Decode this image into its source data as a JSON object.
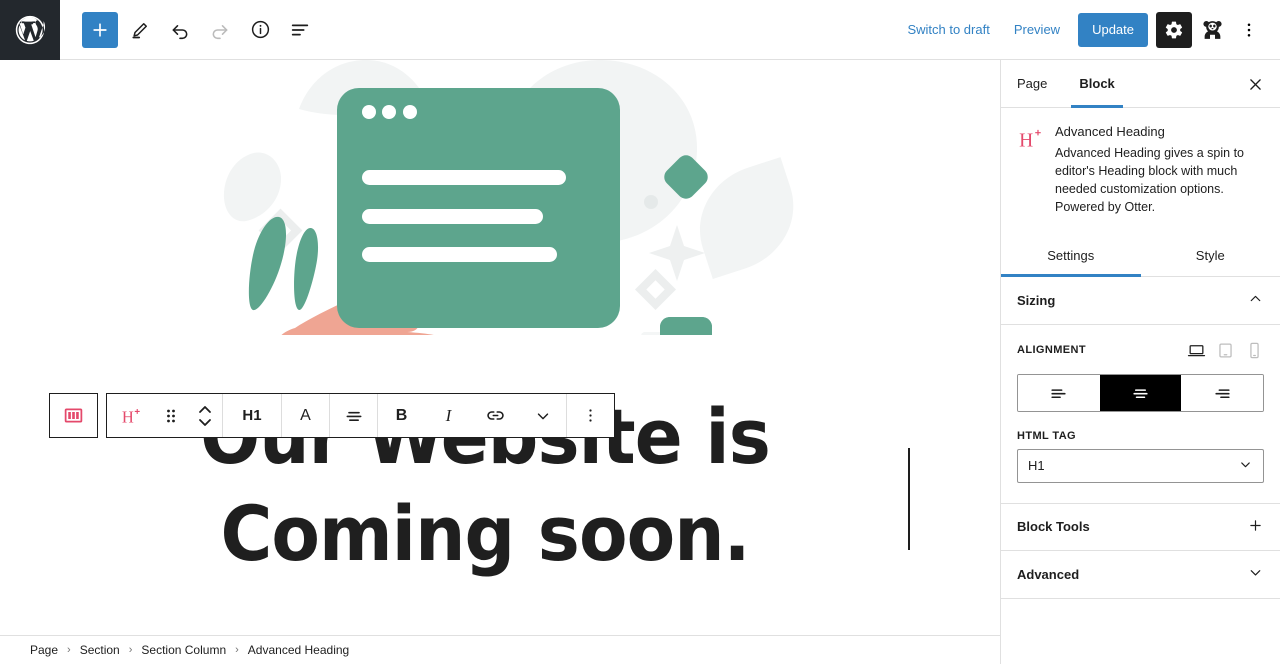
{
  "topbar": {
    "logo_icon": "wordpress-logo-icon",
    "add_block_icon": "plus-icon",
    "edit_icon": "pencil-icon",
    "undo_icon": "undo-arrow-icon",
    "redo_icon": "redo-arrow-icon",
    "info_icon": "info-circle-icon",
    "list_view_icon": "list-view-icon",
    "switch_to_draft_label": "Switch to draft",
    "preview_label": "Preview",
    "update_label": "Update",
    "settings_icon": "gear-icon",
    "avatar_icon": "panda-avatar-icon",
    "more_icon": "kebab-menu-icon",
    "accent_blue": "#3282c4",
    "logo_bg": "#23282d"
  },
  "block_toolbar": {
    "columns_icon": "columns-icon",
    "heading_plus_icon": "advanced-heading-icon",
    "drag_icon": "drag-handle-icon",
    "move_icon": "move-up-down-icon",
    "level_label": "H1",
    "text_color_label": "A",
    "align_icon": "align-center-icon",
    "bold_label": "B",
    "italic_label": "I",
    "link_icon": "link-icon",
    "more_rich_text_icon": "chevron-down-icon",
    "options_icon": "kebab-menu-icon",
    "accent_pink": "#e4496b"
  },
  "canvas": {
    "heading_text": "Our Website is Coming soon.",
    "illustration": {
      "name": "coming-soon-illustration",
      "green": "#5da58d",
      "skin": "#efa593",
      "light_gray": "#f1f3f3"
    }
  },
  "breadcrumb": {
    "items": [
      "Page",
      "Section",
      "Section Column",
      "Advanced Heading"
    ],
    "separator": "›"
  },
  "sidebar": {
    "tabs": [
      {
        "label": "Page",
        "active": false
      },
      {
        "label": "Block",
        "active": true
      }
    ],
    "close_icon": "close-icon",
    "block": {
      "icon": "advanced-heading-icon",
      "title": "Advanced Heading",
      "description": "Advanced Heading gives a spin to editor's Heading block with much needed customization options. Powered by Otter."
    },
    "subtabs": [
      {
        "label": "Settings",
        "active": true
      },
      {
        "label": "Style",
        "active": false
      }
    ],
    "panels": [
      {
        "label": "Sizing",
        "expanded": true,
        "toggle_icon": "chevron-up-icon"
      },
      {
        "label": "Block Tools",
        "expanded": false,
        "toggle_icon": "plus-icon"
      },
      {
        "label": "Advanced",
        "expanded": false,
        "toggle_icon": "chevron-down-icon"
      }
    ],
    "sizing": {
      "alignment_label": "ALIGNMENT",
      "devices": [
        {
          "name": "desktop-icon",
          "selected": true
        },
        {
          "name": "tablet-icon",
          "selected": false
        },
        {
          "name": "mobile-icon",
          "selected": false
        }
      ],
      "alignment_options": [
        {
          "name": "align-left-icon",
          "selected": false
        },
        {
          "name": "align-center-icon",
          "selected": true
        },
        {
          "name": "align-right-icon",
          "selected": false
        }
      ],
      "html_tag_label": "HTML TAG",
      "html_tag_value": "H1",
      "html_tag_chevron": "chevron-down-icon"
    }
  }
}
